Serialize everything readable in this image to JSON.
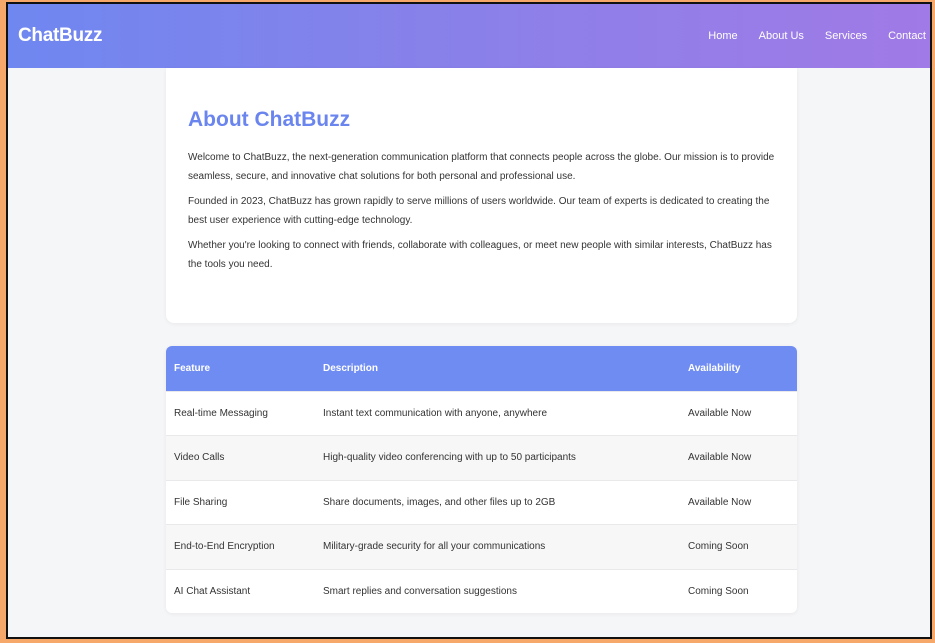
{
  "navbar": {
    "brand": "ChatBuzz",
    "links": [
      "Home",
      "About Us",
      "Services",
      "Contact"
    ]
  },
  "about": {
    "title": "About ChatBuzz",
    "paragraphs": [
      "Welcome to ChatBuzz, the next-generation communication platform that connects people across the globe. Our mission is to provide seamless, secure, and innovative chat solutions for both personal and professional use.",
      "Founded in 2023, ChatBuzz has grown rapidly to serve millions of users worldwide. Our team of experts is dedicated to creating the best user experience with cutting-edge technology.",
      "Whether you're looking to connect with friends, collaborate with colleagues, or meet new people with similar interests, ChatBuzz has the tools you need."
    ]
  },
  "table": {
    "headers": [
      "Feature",
      "Description",
      "Availability"
    ],
    "rows": [
      [
        "Real-time Messaging",
        "Instant text communication with anyone, anywhere",
        "Available Now"
      ],
      [
        "Video Calls",
        "High-quality video conferencing with up to 50 participants",
        "Available Now"
      ],
      [
        "File Sharing",
        "Share documents, images, and other files up to 2GB",
        "Available Now"
      ],
      [
        "End-to-End Encryption",
        "Military-grade security for all your communications",
        "Coming Soon"
      ],
      [
        "AI Chat Assistant",
        "Smart replies and conversation suggestions",
        "Coming Soon"
      ]
    ]
  },
  "colors": {
    "accent": "#6b85ef",
    "nav_gradient_start": "#6f87f0",
    "nav_gradient_end": "#a07ae6"
  }
}
